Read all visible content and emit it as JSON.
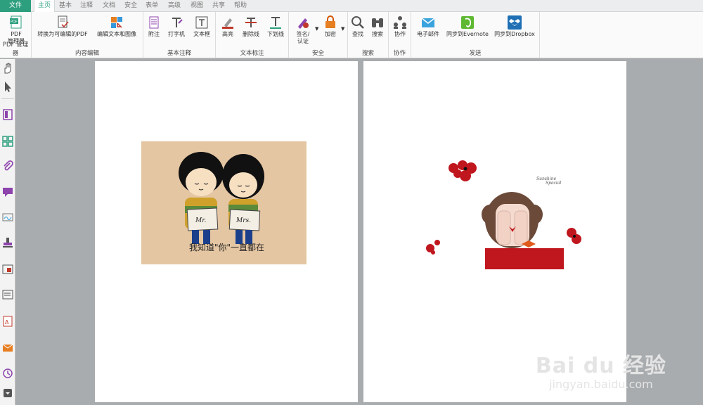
{
  "menu": {
    "file": "文件",
    "tabs": [
      {
        "label": "主页",
        "active": true
      },
      {
        "label": "基本",
        "active": false
      },
      {
        "label": "注释",
        "active": false
      },
      {
        "label": "文档",
        "active": false
      },
      {
        "label": "安全",
        "active": false
      },
      {
        "label": "表单",
        "active": false
      },
      {
        "label": "高级",
        "active": false
      },
      {
        "label": "视图",
        "active": false
      },
      {
        "label": "共享",
        "active": false
      },
      {
        "label": "帮助",
        "active": false
      }
    ]
  },
  "ribbon": {
    "pdf_manager": {
      "button": "PDF\n管理器",
      "button_l1": "PDF",
      "button_l2": "管理器",
      "group": "PDF 管理器"
    },
    "content_edit": {
      "convert": "转换为可编辑的PDF",
      "edit_text_image": "编辑文本和图像",
      "group": "内容编辑"
    },
    "basic_annot": {
      "note": "附注",
      "typewriter": "打字机",
      "textbox": "文本框",
      "group": "基本注释"
    },
    "text_mark": {
      "highlight": "高亮",
      "strikeout": "删除线",
      "underline": "下划线",
      "group": "文本标注"
    },
    "security": {
      "sign_l1": "签名/",
      "sign_l2": "认证",
      "encrypt": "加密",
      "group": "安全"
    },
    "search": {
      "find": "查找",
      "search": "搜索",
      "group": "搜索"
    },
    "collab": {
      "collab": "协作",
      "group": "协作"
    },
    "send": {
      "email": "电子邮件",
      "evernote": "同步到Evernote",
      "dropbox": "同步到Dropbox",
      "group": "发送"
    }
  },
  "document": {
    "image1_caption": "我知道\"你\"一直都在",
    "image1_tag1": "Mr.",
    "image1_tag2": "Mrs.",
    "image2_caption_l1": "Sunshine",
    "image2_caption_l2": "Special"
  },
  "watermark": {
    "main": "Bai du 经验",
    "sub": "jingyan.baidu.com"
  },
  "colors": {
    "accent": "#2d9f7e",
    "ribbon_bg": "#fafafa",
    "doc_bg": "#a9acae"
  }
}
